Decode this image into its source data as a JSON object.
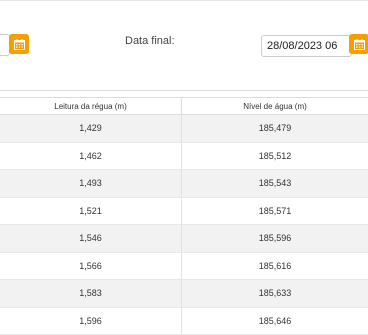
{
  "filters": {
    "end_label": "Data final:",
    "end_value": "28/08/2023 06"
  },
  "table": {
    "headers": [
      "Leitura da régua (m)",
      "Nível de água (m)"
    ],
    "rows": [
      [
        "1,429",
        "185,479"
      ],
      [
        "1,462",
        "185,512"
      ],
      [
        "1,493",
        "185,543"
      ],
      [
        "1,521",
        "185,571"
      ],
      [
        "1,546",
        "185,596"
      ],
      [
        "1,566",
        "185,616"
      ],
      [
        "1,583",
        "185,633"
      ],
      [
        "1,596",
        "185,646"
      ]
    ]
  },
  "colors": {
    "accent": "#f5a000"
  },
  "icons": {
    "calendar": "calendar-icon"
  }
}
